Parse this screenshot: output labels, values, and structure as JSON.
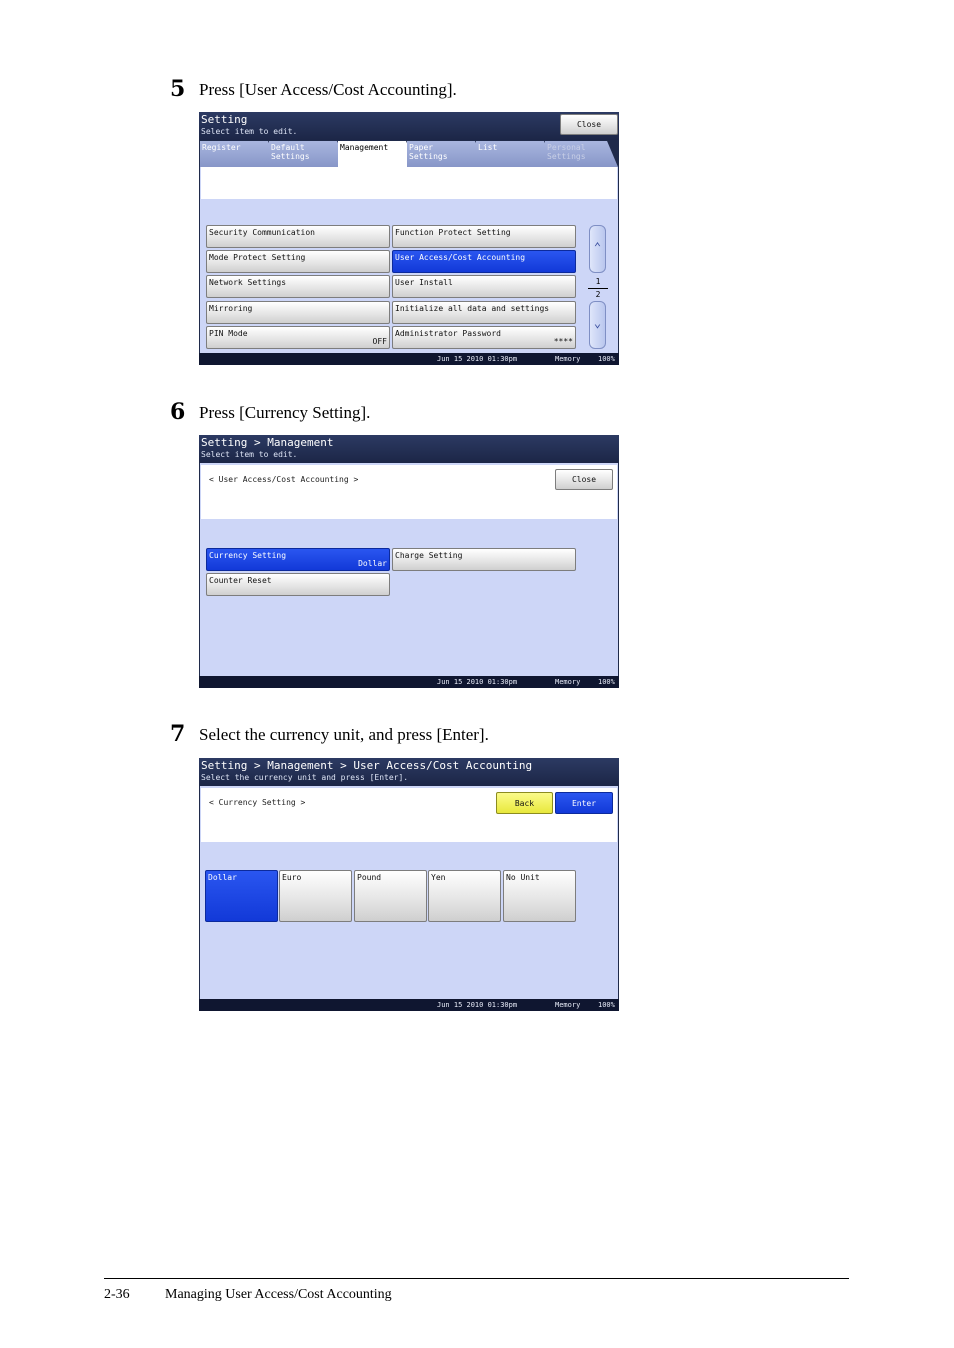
{
  "steps": [
    {
      "num": "5",
      "text": "Press [User Access/Cost Accounting]."
    },
    {
      "num": "6",
      "text": "Press [Currency Setting]."
    },
    {
      "num": "7",
      "text": "Select the currency unit, and press [Enter]."
    }
  ],
  "screen1": {
    "title": "Setting",
    "subtitle": "Select item to edit.",
    "close": "Close",
    "tabs": [
      "Register",
      "Default\nSettings",
      "Management",
      "Paper\nSettings",
      "List",
      "Personal\nSettings"
    ],
    "items": [
      {
        "label": "Security Communication",
        "value": ""
      },
      {
        "label": "Function Protect Setting",
        "value": ""
      },
      {
        "label": "Mode Protect Setting",
        "value": ""
      },
      {
        "label": "User Access/Cost Accounting",
        "value": ""
      },
      {
        "label": "Network Settings",
        "value": ""
      },
      {
        "label": "User Install",
        "value": ""
      },
      {
        "label": "Mirroring",
        "value": ""
      },
      {
        "label": "Initialize all data and settings",
        "value": ""
      },
      {
        "label": "PIN Mode",
        "value": "OFF"
      },
      {
        "label": "Administrator Password",
        "value": "****"
      }
    ],
    "page_current": "1",
    "page_total": "2",
    "footer": {
      "date": "Jun 15 2010 01:30pm",
      "memory": "Memory",
      "percent": "100%"
    }
  },
  "screen2": {
    "title": "Setting > Management",
    "subtitle": "Select item to edit.",
    "breadcrumb": "< User Access/Cost Accounting >",
    "close": "Close",
    "items": [
      {
        "label": "Currency Setting",
        "value": "Dollar"
      },
      {
        "label": "Charge Setting",
        "value": ""
      },
      {
        "label": "Counter Reset",
        "value": ""
      }
    ],
    "footer": {
      "date": "Jun 15 2010 01:30pm",
      "memory": "Memory",
      "percent": "100%"
    }
  },
  "screen3": {
    "title": "Setting > Management > User Access/Cost Accounting",
    "subtitle": "Select the currency unit and press [Enter].",
    "breadcrumb": "< Currency Setting >",
    "back": "Back",
    "enter": "Enter",
    "currencies": [
      "Dollar",
      "Euro",
      "Pound",
      "Yen",
      "No Unit"
    ],
    "footer": {
      "date": "Jun 15 2010 01:30pm",
      "memory": "Memory",
      "percent": "100%"
    }
  },
  "page_footer": {
    "page_number": "2-36",
    "title": "Managing User Access/Cost Accounting"
  },
  "colors": {
    "selected": "#1239d8",
    "panel_bg": "#cdd6f7",
    "header_bg": "#1f2a4a",
    "back_button": "#e8e83c"
  }
}
